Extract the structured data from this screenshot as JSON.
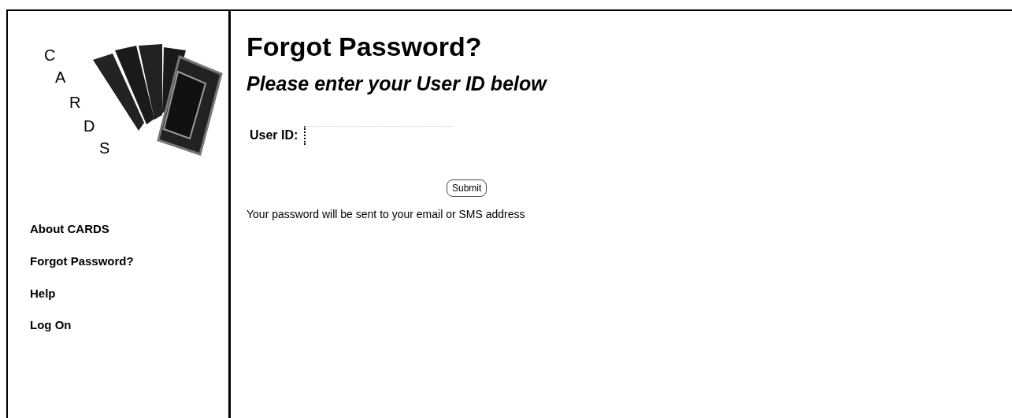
{
  "logo_letters": [
    "C",
    "A",
    "R",
    "D",
    "S"
  ],
  "sidebar": {
    "items": [
      {
        "label": "About CARDS"
      },
      {
        "label": "Forgot Password?"
      },
      {
        "label": "Help"
      },
      {
        "label": "Log On"
      }
    ]
  },
  "title": "Forgot Password?",
  "subtitle": "Please enter your User ID below",
  "form": {
    "label": "User ID:",
    "submit": "Submit"
  },
  "note": "Your password will be sent to your email or SMS address"
}
